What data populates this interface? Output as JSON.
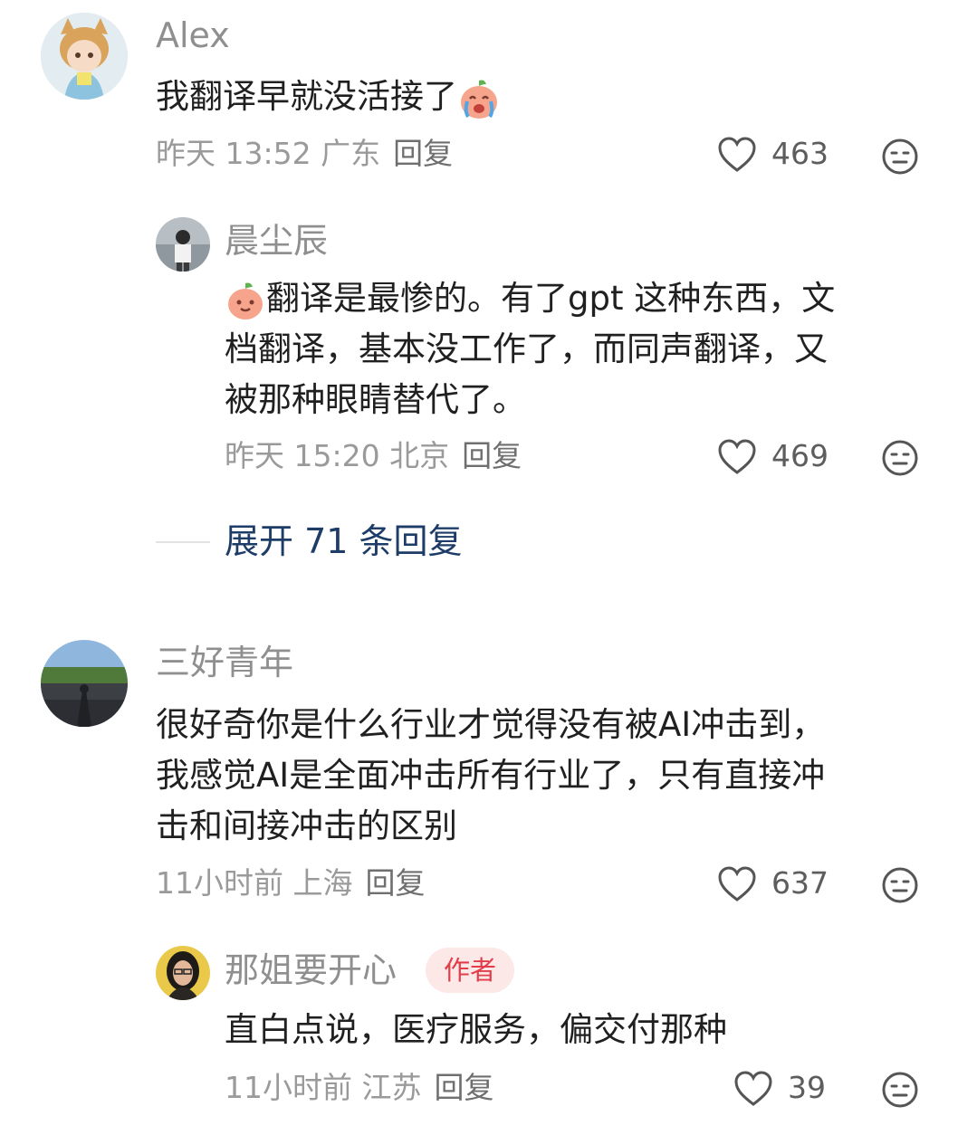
{
  "comments": [
    {
      "user": "Alex",
      "text": "我翻译早就没活接了",
      "emoji": "crying-peach-emoji",
      "meta": "昨天 13:52 广东",
      "reply_label": "回复",
      "likes": "463",
      "reply": {
        "user": "晨尘辰",
        "emoji": "smiling-peach-emoji",
        "lines": [
          "翻译是最惨的。有了gpt 这种东西，文",
          "档翻译，基本没工作了，而同声翻译，又",
          "被那种眼睛替代了。"
        ],
        "meta": "昨天 15:20 北京",
        "reply_label": "回复",
        "likes": "469"
      },
      "expand": "展开 71 条回复"
    },
    {
      "user": "三好青年",
      "lines": [
        "很好奇你是什么行业才觉得没有被AI冲击到，",
        "我感觉AI是全面冲击所有行业了，只有直接冲",
        "击和间接冲击的区别"
      ],
      "meta": "11小时前 上海",
      "reply_label": "回复",
      "likes": "637",
      "reply": {
        "user": "那姐要开心",
        "badge": "作者",
        "text": "直白点说，医疗服务，偏交付那种",
        "meta": "11小时前 江苏",
        "reply_label": "回复",
        "likes": "39"
      }
    }
  ],
  "colors": {
    "name": "#8f8f8f",
    "text": "#202020",
    "expand": "#1e3c68",
    "badge_bg": "#fde8e8",
    "badge_text": "#e13d4a"
  }
}
